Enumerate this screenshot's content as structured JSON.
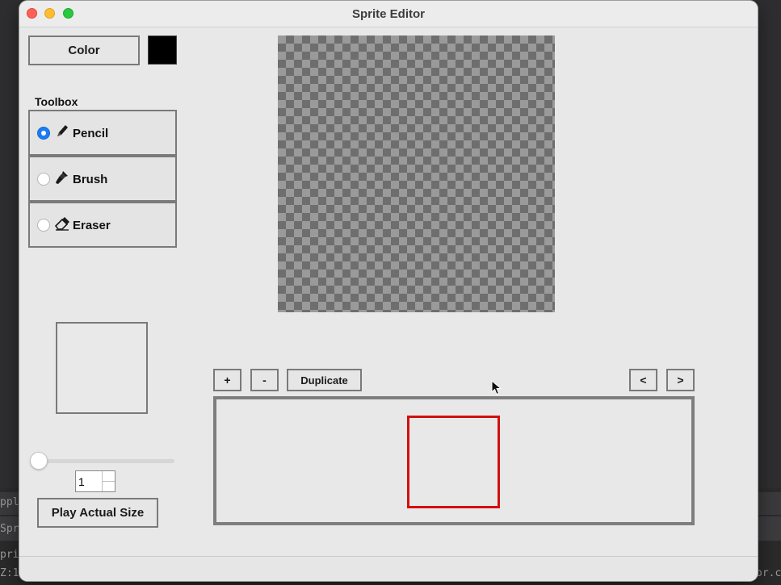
{
  "window": {
    "title": "Sprite Editor"
  },
  "background_fragments": {
    "row1": "ppl",
    "row2": "Spr",
    "row3": "pri",
    "row4": "Z:1",
    "row5": "or.c"
  },
  "color": {
    "button_label": "Color",
    "current_color": "#000000"
  },
  "toolbox": {
    "label": "Toolbox",
    "tools": [
      {
        "label": "Pencil",
        "icon": "pencil-icon",
        "selected": true
      },
      {
        "label": "Brush",
        "icon": "brush-icon",
        "selected": false
      },
      {
        "label": "Eraser",
        "icon": "eraser-icon",
        "selected": false
      }
    ]
  },
  "animation": {
    "scale_value": "1",
    "play_label": "Play Actual Size"
  },
  "frames": {
    "add_label": "+",
    "remove_label": "-",
    "duplicate_label": "Duplicate",
    "prev_label": "<",
    "next_label": ">",
    "selected_frame_color": "#d20f0f"
  }
}
